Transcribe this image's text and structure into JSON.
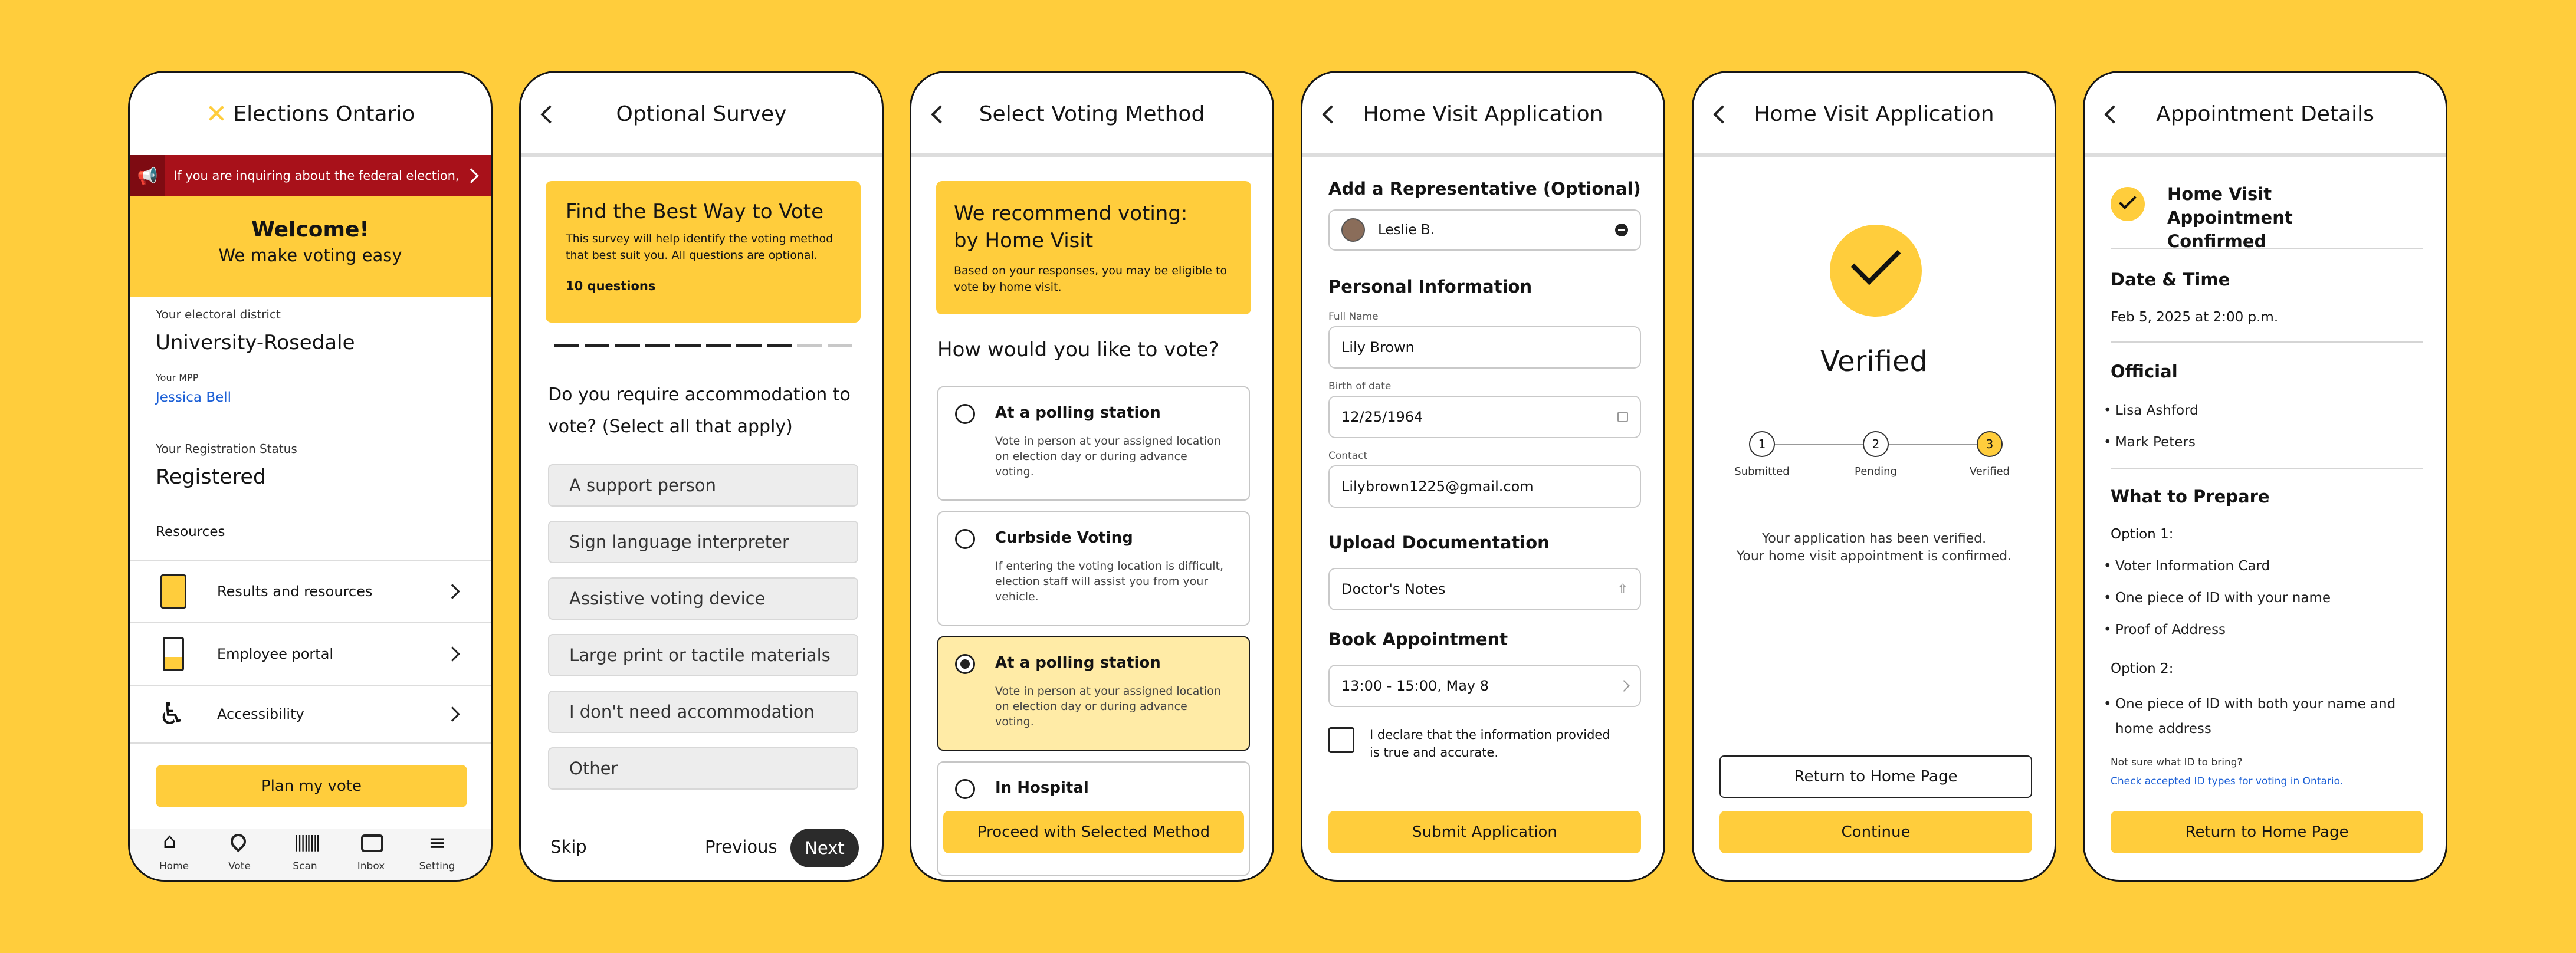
{
  "colors": {
    "brand_yellow": "#FFCD3C",
    "alert_red": "#A8111A",
    "link_blue": "#1B5FD6"
  },
  "screen1": {
    "brand": "Elections Ontario",
    "alert": "If you are inquiring about the federal election, ...",
    "welcome_title": "Welcome!",
    "welcome_sub": "We make voting easy",
    "district_label": "Your electoral district",
    "district_value": "University-Rosedale",
    "mpp_label": "Your MPP",
    "mpp_value": "Jessica Bell",
    "status_label": "Your Registration Status",
    "status_value": "Registered",
    "resources_label": "Resources",
    "resources": [
      {
        "label": "Results and resources",
        "icon": "clipboard-icon"
      },
      {
        "label": "Employee portal",
        "icon": "badge-icon"
      },
      {
        "label": "Accessibility",
        "icon": "wheelchair-icon"
      }
    ],
    "plan_button": "Plan my vote",
    "nav": [
      "Home",
      "Vote",
      "Scan",
      "Inbox",
      "Setting"
    ]
  },
  "screen2": {
    "title": "Optional Survey",
    "card_title": "Find the Best Way to Vote",
    "card_desc": "This survey will help identify the voting method that best suit you. All questions are optional.",
    "card_count": "10 questions",
    "progress": {
      "done": 8,
      "total": 10
    },
    "question": "Do you require accommodation to vote? (Select all that apply)",
    "options": [
      "A support person",
      "Sign language interpreter",
      "Assistive voting device",
      "Large print or tactile materials",
      "I don't need accommodation",
      "Other"
    ],
    "skip": "Skip",
    "previous": "Previous",
    "next": "Next"
  },
  "screen3": {
    "title": "Select Voting Method",
    "rec_title": "We recommend voting: by Home Visit",
    "rec_desc": "Based on your responses, you may be eligible to vote by home visit.",
    "question": "How would you like to vote?",
    "options": [
      {
        "title": "At a polling station",
        "desc": "Vote in person at your assigned location on election day or during advance voting.",
        "selected": false
      },
      {
        "title": "Curbside Voting",
        "desc": "If entering the voting location is difficult, election staff will assist you from your vehicle.",
        "selected": false
      },
      {
        "title": "At a polling station",
        "desc": "Vote in person at your assigned location on election day or during advance voting.",
        "selected": true
      },
      {
        "title": "In Hospital",
        "desc": "",
        "selected": false
      }
    ],
    "proceed": "Proceed with Selected Method"
  },
  "screen4": {
    "title": "Home Visit Application",
    "rep_label": "Add a Representative (Optional)",
    "rep_value": "Leslie B.",
    "personal_label": "Personal Information",
    "fullname_label": "Full Name",
    "fullname_value": "Lily Brown",
    "birth_label": "Birth of date",
    "birth_value": "12/25/1964",
    "contact_label": "Contact",
    "contact_value": "Lilybrown1225@gmail.com",
    "upload_label": "Upload Documentation",
    "upload_value": "Doctor's Notes",
    "book_label": "Book Appointment",
    "book_value": "13:00 - 15:00, May 8",
    "declare": "I declare that the information provided is true and accurate.",
    "submit": "Submit Application"
  },
  "screen5": {
    "title": "Home Visit Application",
    "verified": "Verified",
    "steps": [
      {
        "num": "1",
        "label": "Submitted"
      },
      {
        "num": "2",
        "label": "Pending"
      },
      {
        "num": "3",
        "label": "Verified"
      }
    ],
    "msg1": "Your application has been verified.",
    "msg2": "Your home visit appointment is confirmed.",
    "return": "Return to Home Page",
    "continue": "Continue"
  },
  "screen6": {
    "title": "Appointment Details",
    "confirmed": "Home Visit Appointment Confirmed",
    "date_label": "Date & Time",
    "date_value": "Feb 5, 2025 at 2:00 p.m.",
    "official_label": "Official",
    "officials": [
      "Lisa Ashford",
      "Mark Peters"
    ],
    "prepare_label": "What to Prepare",
    "option1_label": "Option 1:",
    "option1_items": [
      "Voter Information Card",
      "One piece of ID with your name",
      "Proof of Address"
    ],
    "option2_label": "Option 2:",
    "option2_items": [
      "One piece of ID with both your name and home address"
    ],
    "notsure": "Not sure what ID to bring?",
    "link": "Check accepted ID types for voting in Ontario.",
    "return": "Return to Home Page"
  }
}
